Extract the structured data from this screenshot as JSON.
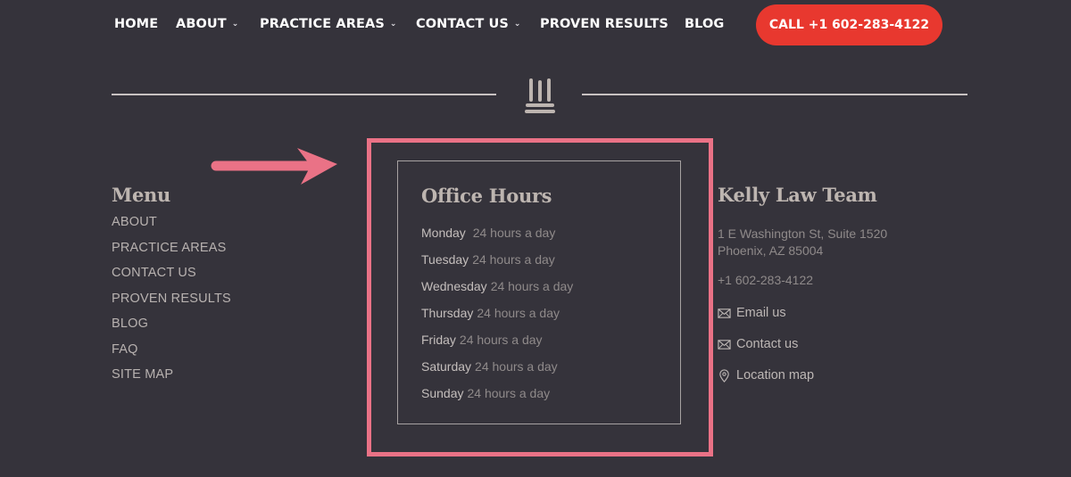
{
  "nav": {
    "items": [
      {
        "label": "HOME",
        "has_dropdown": false
      },
      {
        "label": "ABOUT",
        "has_dropdown": true
      },
      {
        "label": "PRACTICE AREAS",
        "has_dropdown": true
      },
      {
        "label": "CONTACT US",
        "has_dropdown": true
      },
      {
        "label": "PROVEN RESULTS",
        "has_dropdown": false
      },
      {
        "label": "BLOG",
        "has_dropdown": false
      }
    ],
    "chevron": "⌄",
    "call_button": "CALL +1 602-283-4122"
  },
  "logo_icon": "pillars-icon",
  "menu": {
    "title": "Menu",
    "items": [
      "ABOUT",
      "PRACTICE AREAS",
      "CONTACT US",
      "PROVEN RESULTS",
      "BLOG",
      "FAQ",
      "SITE MAP"
    ]
  },
  "office_hours": {
    "title": "Office Hours",
    "rows": [
      {
        "day": "Monday ",
        "hours": "24 hours a day"
      },
      {
        "day": "Tuesday",
        "hours": "24 hours a day"
      },
      {
        "day": "Wednesday",
        "hours": "24 hours a day"
      },
      {
        "day": "Thursday",
        "hours": "24 hours a day"
      },
      {
        "day": "Friday",
        "hours": "24 hours a day"
      },
      {
        "day": "Saturday",
        "hours": "24 hours a day"
      },
      {
        "day": "Sunday",
        "hours": "24 hours a day"
      }
    ]
  },
  "contact": {
    "title": "Kelly Law Team",
    "address_line1": "1 E Washington St, Suite 1520",
    "address_line2": "Phoenix, AZ 85004",
    "phone": "+1 602-283-4122",
    "links": [
      {
        "label": "Email us",
        "icon": "envelope-icon"
      },
      {
        "label": "Contact us",
        "icon": "envelope-icon"
      },
      {
        "label": "Location map",
        "icon": "map-pin-icon"
      }
    ]
  },
  "colors": {
    "background": "#35333b",
    "call_button": "#e8382f",
    "annotation": "#ea7286",
    "heading": "#bdb5b0"
  }
}
